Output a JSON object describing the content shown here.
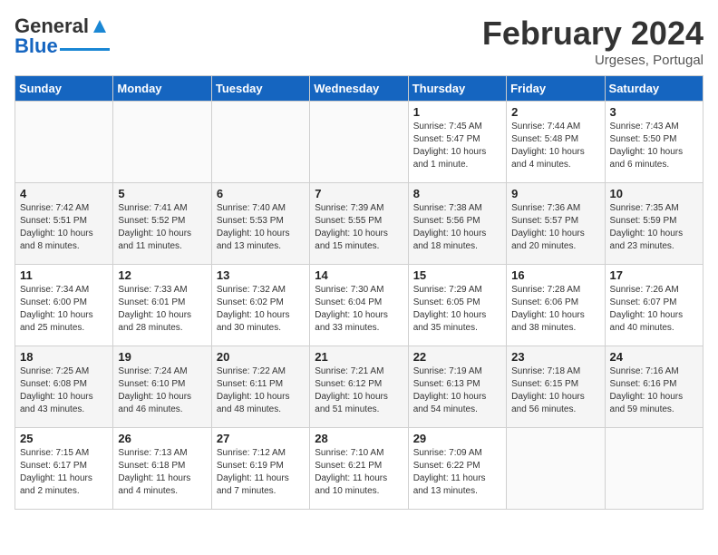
{
  "header": {
    "logo_general": "General",
    "logo_blue": "Blue",
    "month_title": "February 2024",
    "location": "Urgeses, Portugal"
  },
  "calendar": {
    "days_of_week": [
      "Sunday",
      "Monday",
      "Tuesday",
      "Wednesday",
      "Thursday",
      "Friday",
      "Saturday"
    ],
    "weeks": [
      [
        {
          "day": "",
          "info": ""
        },
        {
          "day": "",
          "info": ""
        },
        {
          "day": "",
          "info": ""
        },
        {
          "day": "",
          "info": ""
        },
        {
          "day": "1",
          "info": "Sunrise: 7:45 AM\nSunset: 5:47 PM\nDaylight: 10 hours\nand 1 minute."
        },
        {
          "day": "2",
          "info": "Sunrise: 7:44 AM\nSunset: 5:48 PM\nDaylight: 10 hours\nand 4 minutes."
        },
        {
          "day": "3",
          "info": "Sunrise: 7:43 AM\nSunset: 5:50 PM\nDaylight: 10 hours\nand 6 minutes."
        }
      ],
      [
        {
          "day": "4",
          "info": "Sunrise: 7:42 AM\nSunset: 5:51 PM\nDaylight: 10 hours\nand 8 minutes."
        },
        {
          "day": "5",
          "info": "Sunrise: 7:41 AM\nSunset: 5:52 PM\nDaylight: 10 hours\nand 11 minutes."
        },
        {
          "day": "6",
          "info": "Sunrise: 7:40 AM\nSunset: 5:53 PM\nDaylight: 10 hours\nand 13 minutes."
        },
        {
          "day": "7",
          "info": "Sunrise: 7:39 AM\nSunset: 5:55 PM\nDaylight: 10 hours\nand 15 minutes."
        },
        {
          "day": "8",
          "info": "Sunrise: 7:38 AM\nSunset: 5:56 PM\nDaylight: 10 hours\nand 18 minutes."
        },
        {
          "day": "9",
          "info": "Sunrise: 7:36 AM\nSunset: 5:57 PM\nDaylight: 10 hours\nand 20 minutes."
        },
        {
          "day": "10",
          "info": "Sunrise: 7:35 AM\nSunset: 5:59 PM\nDaylight: 10 hours\nand 23 minutes."
        }
      ],
      [
        {
          "day": "11",
          "info": "Sunrise: 7:34 AM\nSunset: 6:00 PM\nDaylight: 10 hours\nand 25 minutes."
        },
        {
          "day": "12",
          "info": "Sunrise: 7:33 AM\nSunset: 6:01 PM\nDaylight: 10 hours\nand 28 minutes."
        },
        {
          "day": "13",
          "info": "Sunrise: 7:32 AM\nSunset: 6:02 PM\nDaylight: 10 hours\nand 30 minutes."
        },
        {
          "day": "14",
          "info": "Sunrise: 7:30 AM\nSunset: 6:04 PM\nDaylight: 10 hours\nand 33 minutes."
        },
        {
          "day": "15",
          "info": "Sunrise: 7:29 AM\nSunset: 6:05 PM\nDaylight: 10 hours\nand 35 minutes."
        },
        {
          "day": "16",
          "info": "Sunrise: 7:28 AM\nSunset: 6:06 PM\nDaylight: 10 hours\nand 38 minutes."
        },
        {
          "day": "17",
          "info": "Sunrise: 7:26 AM\nSunset: 6:07 PM\nDaylight: 10 hours\nand 40 minutes."
        }
      ],
      [
        {
          "day": "18",
          "info": "Sunrise: 7:25 AM\nSunset: 6:08 PM\nDaylight: 10 hours\nand 43 minutes."
        },
        {
          "day": "19",
          "info": "Sunrise: 7:24 AM\nSunset: 6:10 PM\nDaylight: 10 hours\nand 46 minutes."
        },
        {
          "day": "20",
          "info": "Sunrise: 7:22 AM\nSunset: 6:11 PM\nDaylight: 10 hours\nand 48 minutes."
        },
        {
          "day": "21",
          "info": "Sunrise: 7:21 AM\nSunset: 6:12 PM\nDaylight: 10 hours\nand 51 minutes."
        },
        {
          "day": "22",
          "info": "Sunrise: 7:19 AM\nSunset: 6:13 PM\nDaylight: 10 hours\nand 54 minutes."
        },
        {
          "day": "23",
          "info": "Sunrise: 7:18 AM\nSunset: 6:15 PM\nDaylight: 10 hours\nand 56 minutes."
        },
        {
          "day": "24",
          "info": "Sunrise: 7:16 AM\nSunset: 6:16 PM\nDaylight: 10 hours\nand 59 minutes."
        }
      ],
      [
        {
          "day": "25",
          "info": "Sunrise: 7:15 AM\nSunset: 6:17 PM\nDaylight: 11 hours\nand 2 minutes."
        },
        {
          "day": "26",
          "info": "Sunrise: 7:13 AM\nSunset: 6:18 PM\nDaylight: 11 hours\nand 4 minutes."
        },
        {
          "day": "27",
          "info": "Sunrise: 7:12 AM\nSunset: 6:19 PM\nDaylight: 11 hours\nand 7 minutes."
        },
        {
          "day": "28",
          "info": "Sunrise: 7:10 AM\nSunset: 6:21 PM\nDaylight: 11 hours\nand 10 minutes."
        },
        {
          "day": "29",
          "info": "Sunrise: 7:09 AM\nSunset: 6:22 PM\nDaylight: 11 hours\nand 13 minutes."
        },
        {
          "day": "",
          "info": ""
        },
        {
          "day": "",
          "info": ""
        }
      ]
    ]
  }
}
